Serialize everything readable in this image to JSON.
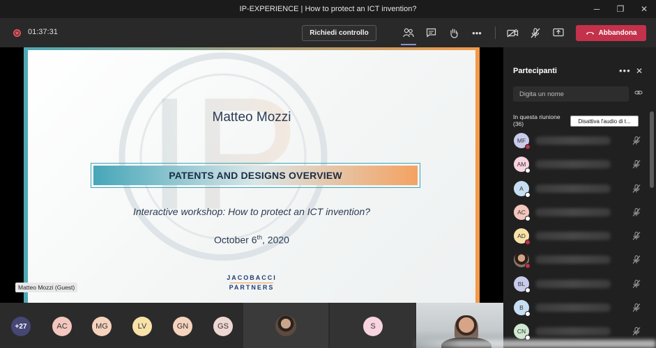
{
  "window": {
    "title": "IP-EXPERIENCE | How to protect an ICT invention?",
    "minimize": "─",
    "maximize": "❐",
    "close": "✕"
  },
  "toolbar": {
    "timer": "01:37:31",
    "request_control": "Richiedi controllo",
    "leave": "Abbandona",
    "more": "•••"
  },
  "slide": {
    "presenter": "Matteo Mozzi",
    "banner": "PATENTS AND DESIGNS OVERVIEW",
    "subtitle": "Interactive workshop: How to protect an ICT invention?",
    "date_prefix": "October 6",
    "date_sup": "th",
    "date_suffix": ", 2020",
    "logo_top": "JACOBACCI",
    "logo_bottom": "PARTNERS",
    "watermark_text": "IP"
  },
  "stage": {
    "guest_label": "Matteo Mozzi (Guest)"
  },
  "gallery": {
    "more_count": "+27",
    "avatars": [
      {
        "initials": "AC",
        "color": "#f3c7bd"
      },
      {
        "initials": "MG",
        "color": "#f6d3bd"
      },
      {
        "initials": "LV",
        "color": "#f8e2a8"
      },
      {
        "initials": "GN",
        "color": "#f6d3bd"
      },
      {
        "initials": "GS",
        "color": "#eed7d2"
      }
    ],
    "speaker_avatar": {
      "initials": "S",
      "color": "#f7d4df"
    }
  },
  "panel": {
    "title": "Partecipanti",
    "more": "•••",
    "close": "✕",
    "search_placeholder": "Digita un nome",
    "meeting_label_line1": "In questa riunione",
    "meeting_label_line2": "(36)",
    "mute_all": "Disattiva l'audio di t...",
    "participants": [
      {
        "initials": "MF",
        "color": "#c9cbeb",
        "status": "#c4314b"
      },
      {
        "initials": "AM",
        "color": "#f7d4df",
        "status": "#ffffff"
      },
      {
        "initials": "A",
        "color": "#c7def2",
        "status": "#ffffff"
      },
      {
        "initials": "AC",
        "color": "#f3c7bd",
        "status": "#ffffff"
      },
      {
        "initials": "AD",
        "color": "#f8e2a8",
        "status": "#c4314b"
      },
      {
        "initials": "",
        "color": "photo",
        "status": "#c4314b"
      },
      {
        "initials": "BL",
        "color": "#c9cbeb",
        "status": "#ffffff"
      },
      {
        "initials": "B",
        "color": "#c7def2",
        "status": "#ffffff"
      },
      {
        "initials": "CN",
        "color": "#cfe8d0",
        "status": "#ffffff"
      }
    ]
  }
}
